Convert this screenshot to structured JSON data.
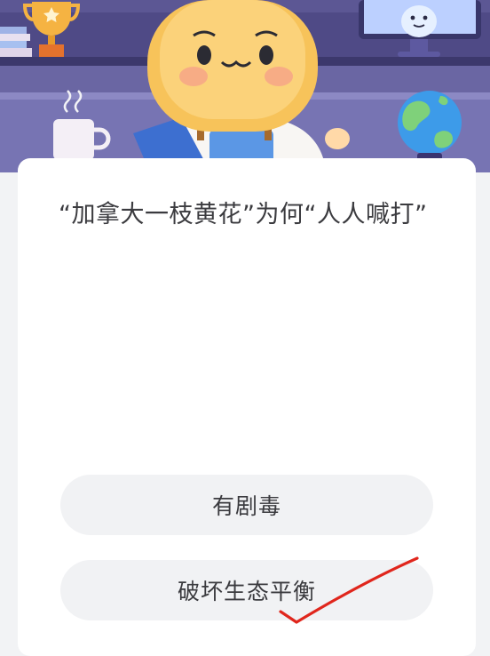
{
  "quiz": {
    "question": "“加拿大一枝黄花”为何“人人喊打”",
    "options": [
      {
        "label": "有剧毒"
      },
      {
        "label": "破坏生态平衡"
      }
    ]
  },
  "colors": {
    "card_background": "#ffffff",
    "option_background": "#f1f2f4",
    "text": "#3b3b3f",
    "check_mark": "#e0261c"
  },
  "icons": [
    "trophy-icon",
    "coffee-cup-icon",
    "globe-icon",
    "mascot-monitor-icon",
    "check-mark-icon"
  ]
}
